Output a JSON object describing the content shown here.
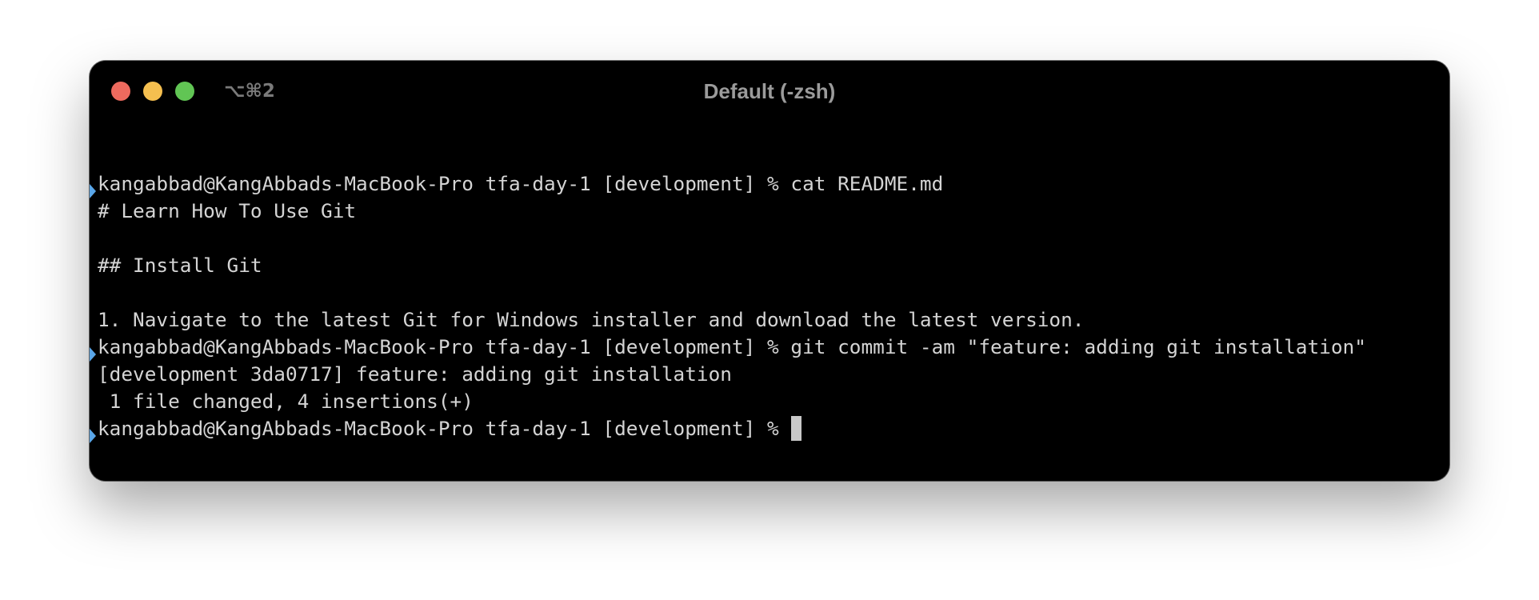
{
  "window": {
    "title": "Default (-zsh)",
    "shortcut": "⌥⌘2",
    "buttons": {
      "close": "close",
      "minimize": "minimize",
      "zoom": "zoom"
    }
  },
  "colors": {
    "background": "#000000",
    "text": "#d4d4d4",
    "title": "#9b9b9b",
    "prompt_marker": "#5aa6e8",
    "cursor": "#c8c8c8",
    "close": "#ed6a5e",
    "minimize": "#f5bf4f",
    "zoom": "#61c554"
  },
  "terminal": {
    "lines": [
      "kangabbad@KangAbbads-MacBook-Pro tfa-day-1 [development] % cat README.md",
      "# Learn How To Use Git",
      "",
      "## Install Git",
      "",
      "1. Navigate to the latest Git for Windows installer and download the latest version.",
      "kangabbad@KangAbbads-MacBook-Pro tfa-day-1 [development] % git commit -am \"feature: adding git installation\"",
      "[development 3da0717] feature: adding git installation",
      " 1 file changed, 4 insertions(+)",
      "kangabbad@KangAbbads-MacBook-Pro tfa-day-1 [development] % "
    ]
  }
}
